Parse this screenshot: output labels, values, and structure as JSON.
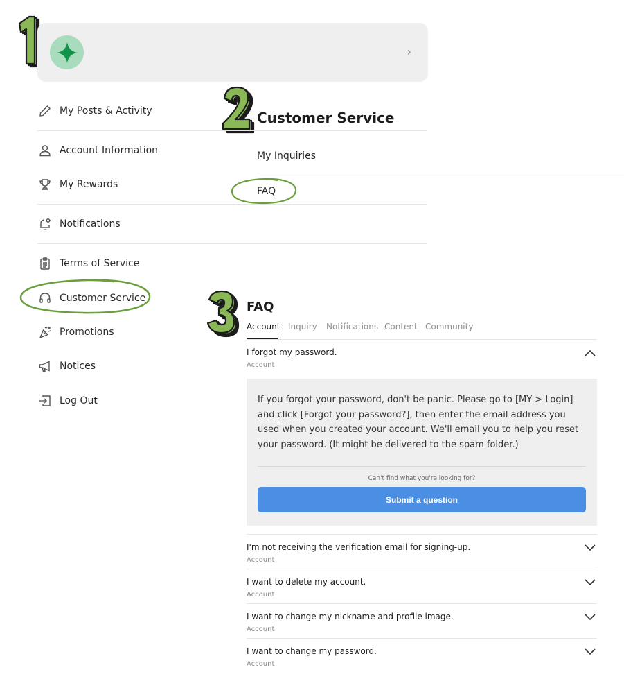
{
  "profile": {
    "chevron": "›"
  },
  "sidebar": {
    "items": [
      {
        "label": "My Posts & Activity",
        "icon": "pencil-icon"
      },
      {
        "label": "Account Information",
        "icon": "user-icon"
      },
      {
        "label": "My Rewards",
        "icon": "trophy-icon"
      },
      {
        "label": "Notifications",
        "icon": "bell-icon"
      },
      {
        "label": "Terms of Service",
        "icon": "clipboard-icon"
      },
      {
        "label": "Customer Service",
        "icon": "headset-icon"
      },
      {
        "label": "Promotions",
        "icon": "party-popper-icon"
      },
      {
        "label": "Notices",
        "icon": "megaphone-icon"
      },
      {
        "label": "Log Out",
        "icon": "logout-icon"
      }
    ]
  },
  "customer_service": {
    "title": "Customer Service",
    "links": [
      "My Inquiries",
      "FAQ"
    ]
  },
  "faq": {
    "title": "FAQ",
    "tabs": [
      "Account",
      "Inquiry",
      "Notifications",
      "Content",
      "Community"
    ],
    "active_tab": "Account",
    "items": [
      {
        "question": "I forgot my password.",
        "category": "Account",
        "expanded": true
      },
      {
        "question": "I'm not receiving the verification email for signing-up.",
        "category": "Account",
        "expanded": false
      },
      {
        "question": "I want to delete my account.",
        "category": "Account",
        "expanded": false
      },
      {
        "question": "I want to change my nickname and profile image.",
        "category": "Account",
        "expanded": false
      },
      {
        "question": "I want to change my password.",
        "category": "Account",
        "expanded": false
      }
    ],
    "answer": "If you forgot your password, don't be panic. Please go to [MY > Login] and click [Forgot your password?], then enter the email address you used when you created your account. We'll email you to help you reset your password. (It might be delivered to the spam folder.)",
    "cant_find": "Can't find what you're looking for?",
    "submit_label": "Submit a question"
  },
  "steps": [
    "1",
    "2",
    "3"
  ],
  "colors": {
    "highlight_green": "#6b9e3d",
    "step_green": "#7fae4a",
    "avatar_bg": "#a9dbbd",
    "avatar_star": "#12934a",
    "submit_blue": "#4a8fe3"
  }
}
